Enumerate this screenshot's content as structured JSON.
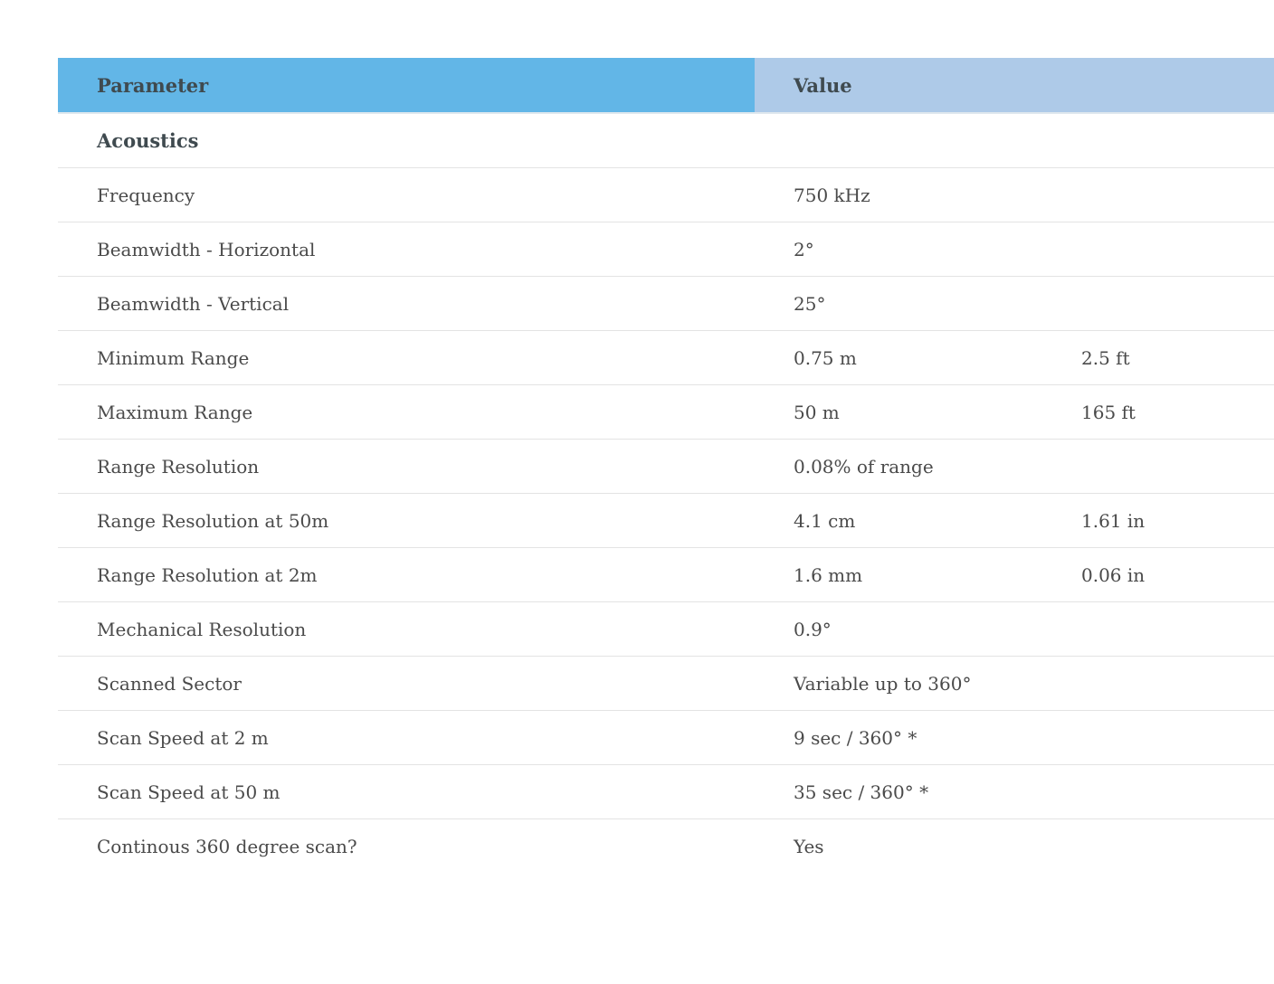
{
  "table": {
    "header": {
      "parameter": "Parameter",
      "value": "Value"
    },
    "rows": [
      {
        "parameter": "Acoustics",
        "value": "",
        "alt": "",
        "section": true
      },
      {
        "parameter": "Frequency",
        "value": "750 kHz",
        "alt": ""
      },
      {
        "parameter": "Beamwidth - Horizontal",
        "value": "2°",
        "alt": ""
      },
      {
        "parameter": "Beamwidth - Vertical",
        "value": "25°",
        "alt": ""
      },
      {
        "parameter": "Minimum Range",
        "value": "0.75 m",
        "alt": "2.5 ft"
      },
      {
        "parameter": "Maximum Range",
        "value": "50 m",
        "alt": "165 ft"
      },
      {
        "parameter": "Range Resolution",
        "value": "0.08% of range",
        "alt": ""
      },
      {
        "parameter": "Range Resolution at 50m",
        "value": "4.1 cm",
        "alt": "1.61 in"
      },
      {
        "parameter": "Range Resolution at 2m",
        "value": "1.6 mm",
        "alt": "0.06 in"
      },
      {
        "parameter": "Mechanical Resolution",
        "value": "0.9°",
        "alt": ""
      },
      {
        "parameter": "Scanned Sector",
        "value": "Variable up to 360°",
        "alt": ""
      },
      {
        "parameter": "Scan Speed at 2 m",
        "value": "9 sec / 360° *",
        "alt": ""
      },
      {
        "parameter": "Scan Speed at 50 m",
        "value": "35 sec / 360° *",
        "alt": ""
      },
      {
        "parameter": "Continous 360 degree scan?",
        "value": "Yes",
        "alt": ""
      }
    ]
  },
  "colors": {
    "header_param_bg": "#62b6e7",
    "header_value_bg": "#aecae8",
    "text": "#4a4a4a",
    "row_divider": "#e3e3e3"
  }
}
